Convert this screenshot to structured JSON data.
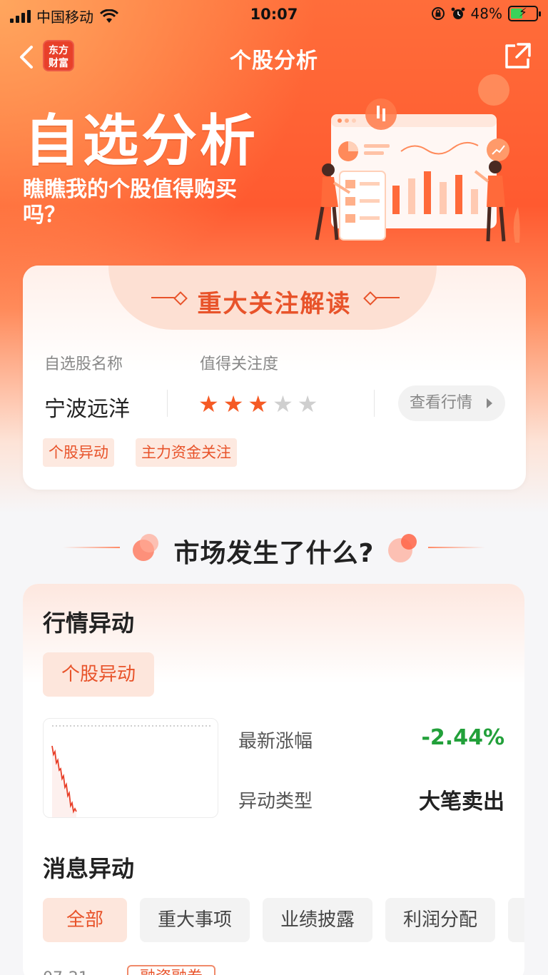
{
  "status_bar": {
    "carrier": "中国移动",
    "time": "10:07",
    "battery": "48%",
    "battery_level": 0.48,
    "icons": [
      "signal-icon",
      "wifi-icon",
      "orientation-lock-icon",
      "alarm-icon",
      "battery-charging-icon"
    ]
  },
  "navbar": {
    "title": "个股分析",
    "logo_text": "东方\n财富",
    "back_icon": "chevron-left-icon",
    "share_icon": "share-icon"
  },
  "hero": {
    "title": "自选分析",
    "subtitle": "瞧瞧我的个股值得购买吗？"
  },
  "focus_card": {
    "title": "重大关注解读",
    "name_label": "自选股名称",
    "attention_label": "值得关注度",
    "stock_name": "宁波远洋",
    "stars_total": 5,
    "stars_filled": 3,
    "view_button": "查看行情",
    "tags": [
      "个股异动",
      "主力资金关注"
    ]
  },
  "market_section": {
    "title": "市场发生了什么?"
  },
  "market_card": {
    "quote_title": "行情异动",
    "quote_chip": "个股异动",
    "latest_change_label": "最新涨幅",
    "latest_change_value": "-2.44%",
    "change_color": "#22a03a",
    "anomaly_type_label": "异动类型",
    "anomaly_type_value": "大笔卖出",
    "news_title": "消息异动",
    "filters": [
      "全部",
      "重大事项",
      "业绩披露",
      "利润分配"
    ],
    "active_filter": 0,
    "peek_date": "07-21",
    "peek_tag": "融资融券"
  },
  "colors": {
    "accent": "#e8532a",
    "hero_orange": "#ff5a30",
    "chart_line": "#e8402a"
  }
}
